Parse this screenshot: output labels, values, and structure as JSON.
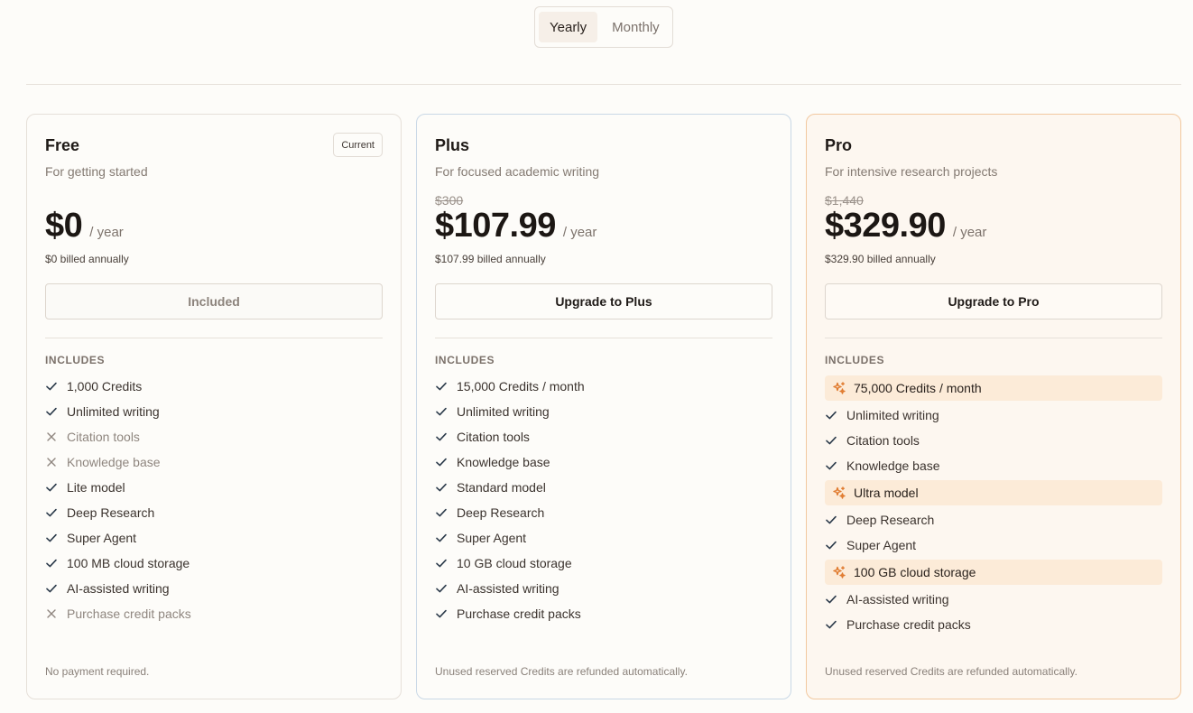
{
  "toggle": {
    "yearly": "Yearly",
    "monthly": "Monthly"
  },
  "includes_label": "INCLUDES",
  "plans": [
    {
      "name": "Free",
      "badge": "Current",
      "description": "For getting started",
      "price": "$0",
      "period": "/ year",
      "billed": "$0 billed annually",
      "cta": "Included",
      "features": [
        {
          "label": "1,000 Credits",
          "status": "check"
        },
        {
          "label": "Unlimited writing",
          "status": "check"
        },
        {
          "label": "Citation tools",
          "status": "cross"
        },
        {
          "label": "Knowledge base",
          "status": "cross"
        },
        {
          "label": "Lite model",
          "status": "check"
        },
        {
          "label": "Deep Research",
          "status": "check"
        },
        {
          "label": "Super Agent",
          "status": "check"
        },
        {
          "label": "100 MB cloud storage",
          "status": "check"
        },
        {
          "label": "AI-assisted writing",
          "status": "check"
        },
        {
          "label": "Purchase credit packs",
          "status": "cross"
        }
      ],
      "footnote": "No payment required."
    },
    {
      "name": "Plus",
      "description": "For focused academic writing",
      "old_price": "$300",
      "price": "$107.99",
      "period": "/ year",
      "billed": "$107.99 billed annually",
      "cta": "Upgrade to Plus",
      "features": [
        {
          "label": "15,000 Credits / month",
          "status": "check"
        },
        {
          "label": "Unlimited writing",
          "status": "check"
        },
        {
          "label": "Citation tools",
          "status": "check"
        },
        {
          "label": "Knowledge base",
          "status": "check"
        },
        {
          "label": "Standard model",
          "status": "check"
        },
        {
          "label": "Deep Research",
          "status": "check"
        },
        {
          "label": "Super Agent",
          "status": "check"
        },
        {
          "label": "10 GB cloud storage",
          "status": "check"
        },
        {
          "label": "AI-assisted writing",
          "status": "check"
        },
        {
          "label": "Purchase credit packs",
          "status": "check"
        }
      ],
      "footnote": "Unused reserved Credits are refunded automatically."
    },
    {
      "name": "Pro",
      "description": "For intensive research projects",
      "old_price": "$1,440",
      "price": "$329.90",
      "period": "/ year",
      "billed": "$329.90 billed annually",
      "cta": "Upgrade to Pro",
      "features": [
        {
          "label": "75,000 Credits / month",
          "status": "highlight"
        },
        {
          "label": "Unlimited writing",
          "status": "check"
        },
        {
          "label": "Citation tools",
          "status": "check"
        },
        {
          "label": "Knowledge base",
          "status": "check"
        },
        {
          "label": "Ultra model",
          "status": "highlight"
        },
        {
          "label": "Deep Research",
          "status": "check"
        },
        {
          "label": "Super Agent",
          "status": "check"
        },
        {
          "label": "100 GB cloud storage",
          "status": "highlight"
        },
        {
          "label": "AI-assisted writing",
          "status": "check"
        },
        {
          "label": "Purchase credit packs",
          "status": "check"
        }
      ],
      "footnote": "Unused reserved Credits are refunded automatically."
    }
  ],
  "colors": {
    "accent_orange": "#e07a2e",
    "highlight_bg": "#fcebd8",
    "pro_border": "#f2c89f",
    "plus_border": "#c9d8e6"
  }
}
